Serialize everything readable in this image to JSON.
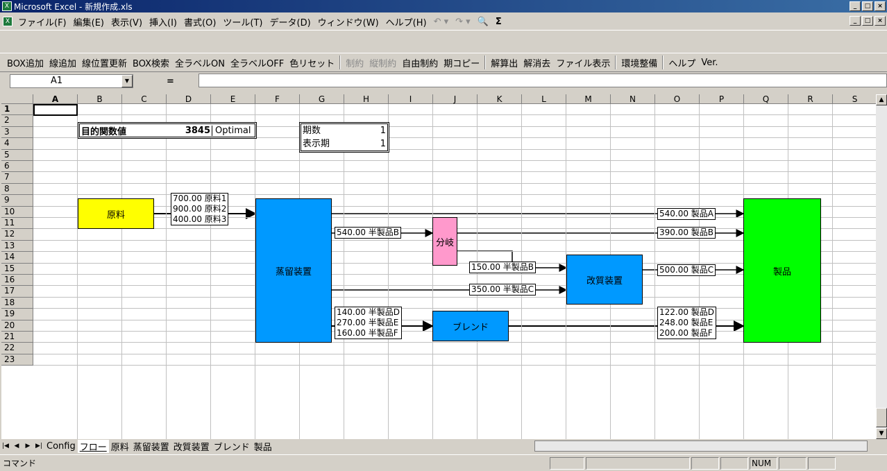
{
  "window": {
    "title": "Microsoft Excel - 新規作成.xls",
    "min": "_",
    "max": "□",
    "close": "×"
  },
  "menu": [
    "ファイル(F)",
    "編集(E)",
    "表示(V)",
    "挿入(I)",
    "書式(O)",
    "ツール(T)",
    "データ(D)",
    "ウィンドウ(W)",
    "ヘルプ(H)"
  ],
  "menu_extra": {
    "undo": "↶ ▾",
    "redo": "↷ ▾",
    "find": "🔍",
    "sum": "Σ"
  },
  "toolbar": {
    "items": [
      {
        "label": "BOX追加",
        "enabled": true
      },
      {
        "label": "線追加",
        "enabled": true
      },
      {
        "label": "線位置更新",
        "enabled": true
      },
      {
        "label": "BOX検索",
        "enabled": true
      },
      {
        "label": "全ラベルON",
        "enabled": true
      },
      {
        "label": "全ラベルOFF",
        "enabled": true
      },
      {
        "label": "色リセット",
        "enabled": true
      }
    ],
    "items2": [
      {
        "label": "制約",
        "enabled": false
      },
      {
        "label": "縦制約",
        "enabled": false
      },
      {
        "label": "自由制約",
        "enabled": true
      },
      {
        "label": "期コピー",
        "enabled": true
      }
    ],
    "items3": [
      {
        "label": "解算出"
      },
      {
        "label": "解消去"
      },
      {
        "label": "ファイル表示"
      }
    ],
    "items4": [
      {
        "label": "環境整備"
      }
    ],
    "items5": [
      {
        "label": "ヘルプ"
      },
      {
        "label": "Ver."
      }
    ]
  },
  "formula": {
    "namebox": "A1",
    "eq": "=",
    "value": ""
  },
  "columns": [
    "A",
    "B",
    "C",
    "D",
    "E",
    "F",
    "G",
    "H",
    "I",
    "J",
    "K",
    "L",
    "M",
    "N",
    "O",
    "P",
    "Q",
    "R",
    "S"
  ],
  "rows": [
    "1",
    "2",
    "3",
    "4",
    "5",
    "6",
    "7",
    "8",
    "9",
    "10",
    "11",
    "12",
    "13",
    "14",
    "15",
    "16",
    "17",
    "18",
    "19",
    "20",
    "21",
    "22",
    "23"
  ],
  "objective": {
    "label": "目的関数値",
    "value": "3845",
    "status": "Optimal"
  },
  "period": {
    "label1": "期数",
    "val1": "1",
    "label2": "表示期",
    "val2": "1"
  },
  "boxes": {
    "raw": "原料",
    "distill": "蒸留装置",
    "branch": "分岐",
    "reform": "改質装置",
    "blend": "ブレンド",
    "product": "製品"
  },
  "colors": {
    "raw": "#ffff00",
    "distill": "#0099ff",
    "branch": "#ff99cc",
    "reform": "#0099ff",
    "blend": "#0099ff",
    "product": "#00ff00"
  },
  "labels": {
    "raw_out": [
      "700.00 原料1",
      "900.00 原料2",
      "400.00 原料3"
    ],
    "semiB": "540.00 半製品B",
    "prodA": "540.00 製品A",
    "prodB": "390.00 製品B",
    "semiB2": "150.00 半製品B",
    "semiC": "350.00 半製品C",
    "prodC": "500.00 製品C",
    "semiDEF": [
      "140.00 半製品D",
      "270.00 半製品E",
      "160.00 半製品F"
    ],
    "prodDEF": [
      "122.00 製品D",
      "248.00 製品E",
      "200.00 製品F"
    ]
  },
  "tabs": {
    "nav": [
      "|◀",
      "◀",
      "▶",
      "▶|"
    ],
    "sheets": [
      "Config",
      "フロー",
      "原料",
      "蒸留装置",
      "改質装置",
      "ブレンド",
      "製品"
    ],
    "active": 1
  },
  "status": {
    "mode": "コマンド",
    "num": "NUM"
  }
}
